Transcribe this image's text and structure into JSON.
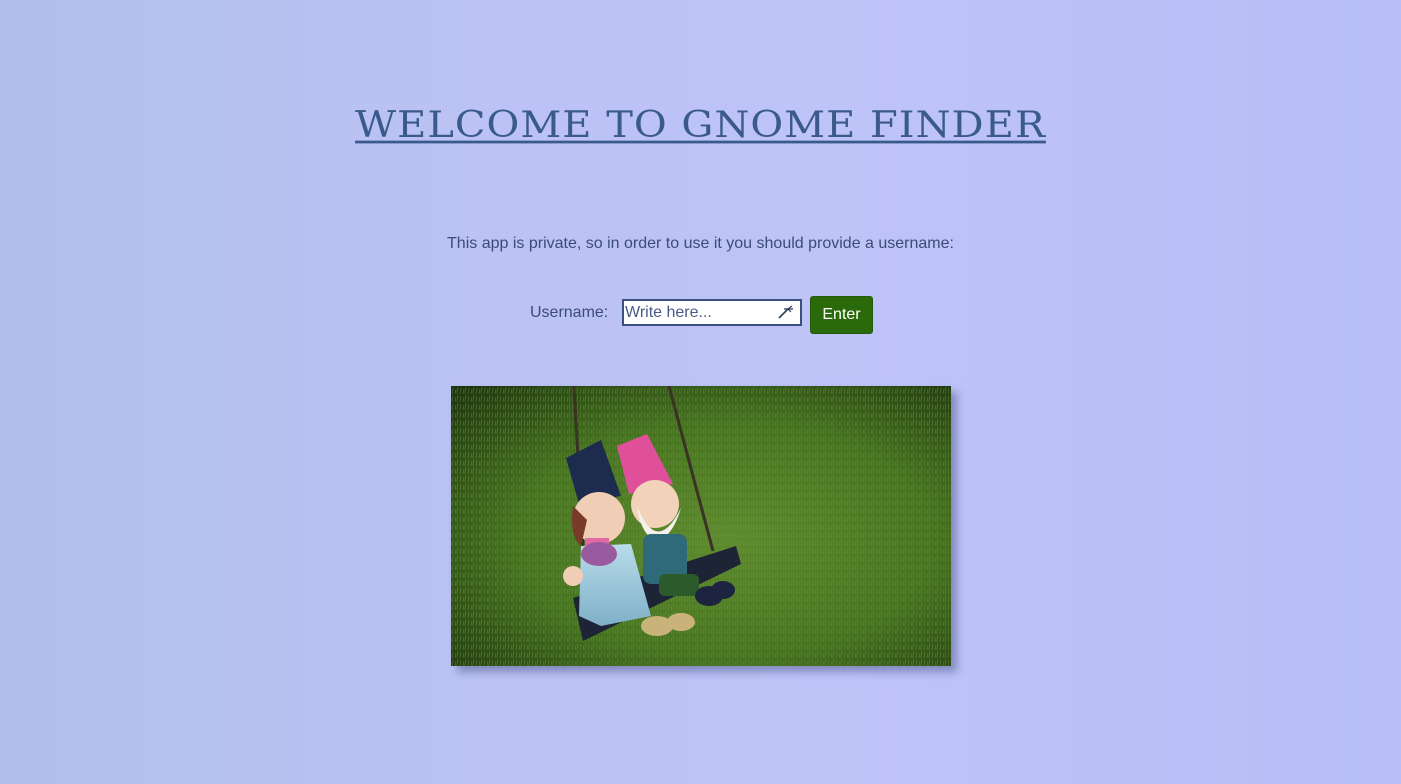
{
  "header": {
    "title": "WELCOME TO GNOME FINDER"
  },
  "intro": {
    "text": "This app is private, so in order to use it you should provide a username:"
  },
  "login_form": {
    "username_label": "Username:",
    "username_placeholder": "Write here...",
    "username_value": "",
    "enter_button_label": "Enter"
  },
  "colors": {
    "title": "#3a5a8c",
    "text": "#3c4c78",
    "button_bg": "#2a6a0b",
    "input_border": "#3b4f7e"
  },
  "image": {
    "icon": "gnomes-on-swing-photo"
  }
}
